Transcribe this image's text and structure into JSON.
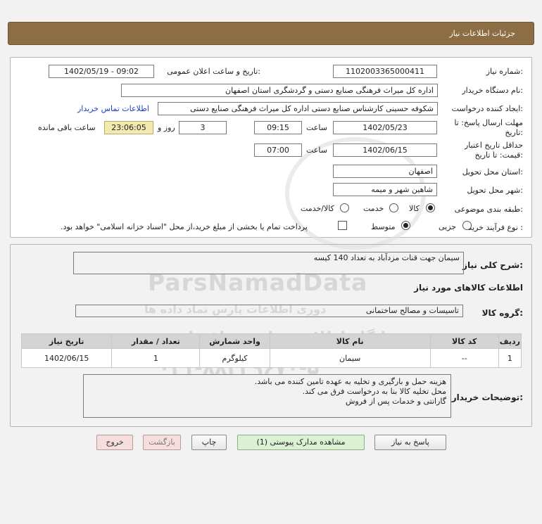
{
  "header": {
    "title": "جزئیات اطلاعات نیاز"
  },
  "form": {
    "need_number_label": "شماره نیاز:",
    "need_number": "1102003365000411",
    "announce_label": "تاریخ و ساعت اعلان عمومی:",
    "announce_value": "1402/05/19 - 09:02",
    "buyer_label": "نام دستگاه خریدار:",
    "buyer_value": "اداره کل میراث فرهنگی  صنایع دستی و گردشگری استان اصفهان",
    "creator_label": "ایجاد کننده درخواست:",
    "creator_value": "شکوفه حسینی کارشناس صنایع دستی اداره کل میراث فرهنگی  صنایع دستی",
    "contact_link": "اطلاعات تماس خریدار",
    "reply_deadline_label_1": "مهلت ارسال پاسخ: تا",
    "reply_deadline_label_2": "تاریخ:",
    "reply_date": "1402/05/23",
    "time_label": "ساعت",
    "reply_time": "09:15",
    "days_value": "3",
    "days_label": "روز و",
    "remaining_time": "23:06:05",
    "remaining_label": "ساعت باقی مانده",
    "validity_label_1": "حداقل تاریخ اعتبار",
    "validity_label_2": "قیمت: تا تاریخ:",
    "validity_date": "1402/06/15",
    "validity_time": "07:00",
    "province_label": "استان محل تحویل:",
    "province_value": "اصفهان",
    "city_label": "شهر محل تحویل:",
    "city_value": "شاهین شهر و میمه",
    "category_label": "طبقه بندی موضوعی:",
    "category_options": [
      "کالا",
      "خدمت",
      "کالا/خدمت"
    ],
    "process_label": "نوع فرآیند خرید :",
    "process_options": [
      "جزیی",
      "متوسط"
    ],
    "payment_note": "پرداخت تمام یا بخشی از مبلغ خرید،از محل \"اسناد خزانه اسلامی\" خواهد بود."
  },
  "summary": {
    "label": "شرح کلی نیاز:",
    "value": "سیمان جهت قنات مزدآباد به تعداد 140 کیسه",
    "goods_info_title": "اطلاعات کالاهای مورد نیاز",
    "group_label": "گروه کالا:",
    "group_value": "تاسیسات و مصالح ساختمانی"
  },
  "table": {
    "headers": [
      "ردیف",
      "کد کالا",
      "نام کالا",
      "واحد شمارش",
      "تعداد / مقدار",
      "تاریخ نیاز"
    ],
    "row": [
      "1",
      "--",
      "سیمان",
      "کیلوگرم",
      "1",
      "1402/06/15"
    ]
  },
  "notes": {
    "label": "توضیحات خریدار:",
    "line1": "هزینه حمل و بارگیری و تخلیه به عهده تامین کننده می باشد.",
    "line2": "محل تخلیه کالا بنا به درخواست فرق می کند.",
    "line3": "گارانتی و خدمات پس از فروش"
  },
  "buttons": {
    "reply": "پاسخ به نیاز",
    "attachments": "مشاهده مدارک پیوستی (1)",
    "print": "چاپ",
    "back": "بازگشت",
    "exit": "خروج"
  },
  "watermark": {
    "brand": "ParsNamadData",
    "line1": "پایگاه اطلاع رسانی مناقصات",
    "line2": "۰۲۱-۸۸۳۴۹۶۷۰-۵",
    "line3": "دوری اطلاعات پارس نماد داده ها"
  },
  "colors": {
    "header_bg": "#8d6e44",
    "remaining_bg": "#f2eab0",
    "link": "#1a3fc4",
    "attachments_btn": "#dcf1d3",
    "back_btn": "#f6dede"
  }
}
